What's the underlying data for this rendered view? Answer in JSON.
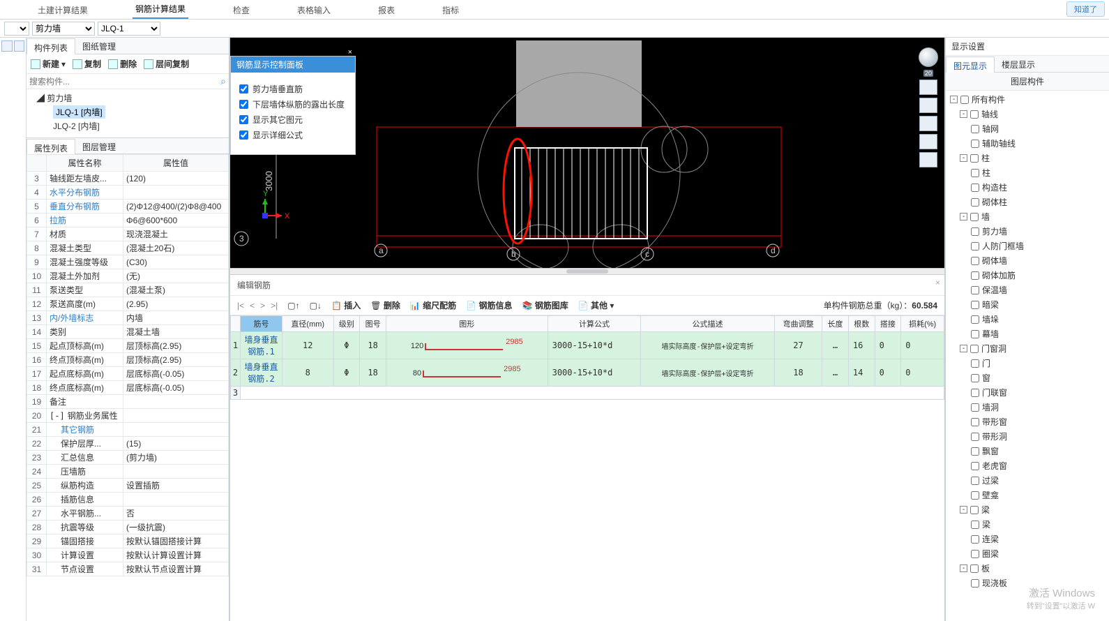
{
  "top_tabs": [
    "土建计算结果",
    "钢筋计算结果",
    "检查",
    "表格输入",
    "报表",
    "指标"
  ],
  "top_tabs_active": 1,
  "know_it": "知道了",
  "dd": {
    "first": "",
    "cat": "剪力墙",
    "item": "JLQ-1"
  },
  "left": {
    "tabs": [
      "构件列表",
      "图纸管理"
    ],
    "toolbar": {
      "new": "新建",
      "copy": "复制",
      "del": "删除",
      "floorcopy": "层间复制"
    },
    "search_ph": "搜索构件...",
    "tree_root": "剪力墙",
    "tree_items": [
      "JLQ-1 [内墙]",
      "JLQ-2 [内墙]"
    ],
    "tree_sel": 0,
    "tabs2": [
      "属性列表",
      "图层管理"
    ],
    "prop_headers": [
      "",
      "属性名称",
      "属性值"
    ],
    "props": [
      {
        "n": "3",
        "name": "轴线距左墙皮...",
        "val": "(120)"
      },
      {
        "n": "4",
        "name": "水平分布钢筋",
        "val": "",
        "blue": true
      },
      {
        "n": "5",
        "name": "垂直分布钢筋",
        "val": "(2)Φ12@400/(2)Φ8@400",
        "blue": true
      },
      {
        "n": "6",
        "name": "拉筋",
        "val": "Φ6@600*600",
        "blue": true
      },
      {
        "n": "7",
        "name": "材质",
        "val": "现浇混凝土"
      },
      {
        "n": "8",
        "name": "混凝土类型",
        "val": "(混凝土20石)"
      },
      {
        "n": "9",
        "name": "混凝土强度等级",
        "val": "(C30)"
      },
      {
        "n": "10",
        "name": "混凝土外加剂",
        "val": "(无)"
      },
      {
        "n": "11",
        "name": "泵送类型",
        "val": "(混凝土泵)"
      },
      {
        "n": "12",
        "name": "泵送高度(m)",
        "val": "(2.95)"
      },
      {
        "n": "13",
        "name": "内/外墙标志",
        "val": "内墙",
        "blue": true
      },
      {
        "n": "14",
        "name": "类别",
        "val": "混凝土墙"
      },
      {
        "n": "15",
        "name": "起点顶标高(m)",
        "val": "层顶标高(2.95)"
      },
      {
        "n": "16",
        "name": "终点顶标高(m)",
        "val": "层顶标高(2.95)"
      },
      {
        "n": "17",
        "name": "起点底标高(m)",
        "val": "层底标高(-0.05)"
      },
      {
        "n": "18",
        "name": "终点底标高(m)",
        "val": "层底标高(-0.05)"
      },
      {
        "n": "19",
        "name": "备注",
        "val": ""
      },
      {
        "n": "20",
        "name": "钢筋业务属性",
        "val": "",
        "exp": "-"
      },
      {
        "n": "21",
        "name": "其它钢筋",
        "val": "",
        "indent": 1,
        "blue": true
      },
      {
        "n": "22",
        "name": "保护层厚...",
        "val": "(15)",
        "indent": 1
      },
      {
        "n": "23",
        "name": "汇总信息",
        "val": "(剪力墙)",
        "indent": 1
      },
      {
        "n": "24",
        "name": "压墙筋",
        "val": "",
        "indent": 1
      },
      {
        "n": "25",
        "name": "纵筋构造",
        "val": "设置插筋",
        "indent": 1
      },
      {
        "n": "26",
        "name": "插筋信息",
        "val": "",
        "indent": 1
      },
      {
        "n": "27",
        "name": "水平钢筋...",
        "val": "否",
        "indent": 1
      },
      {
        "n": "28",
        "name": "抗震等级",
        "val": "(一级抗震)",
        "indent": 1
      },
      {
        "n": "29",
        "name": "锚固搭接",
        "val": "按默认锚固搭接计算",
        "indent": 1
      },
      {
        "n": "30",
        "name": "计算设置",
        "val": "按默认计算设置计算",
        "indent": 1
      },
      {
        "n": "31",
        "name": "节点设置",
        "val": "按默认节点设置计算",
        "indent": 1
      }
    ]
  },
  "floatpanel": {
    "title": "钢筋显示控制面板",
    "items": [
      "剪力墙垂直筋",
      "下层墙体纵筋的露出长度",
      "显示其它图元",
      "显示详细公式"
    ]
  },
  "viewport": {
    "dim_label": "3000",
    "axis_y": "Y",
    "axis_x": "X",
    "mark3": "3",
    "marks": [
      "a",
      "b",
      "c",
      "d"
    ]
  },
  "bottom": {
    "title": "编辑钢筋",
    "btn": {
      "ins": "插入",
      "del": "删除",
      "scale": "缩尺配筋",
      "info": "钢筋信息",
      "lib": "钢筋图库",
      "other": "其他"
    },
    "weight_label": "单构件钢筋总重（kg）：",
    "weight_val": "60.584",
    "cols": [
      "",
      "筋号",
      "直径(mm)",
      "级别",
      "图号",
      "图形",
      "计算公式",
      "公式描述",
      "弯曲调整",
      "长度",
      "根数",
      "搭接",
      "损耗(%)"
    ],
    "rows": [
      {
        "idx": "1",
        "name": "墙身垂直钢筋.1",
        "dia": "12",
        "grade": "Φ",
        "code": "18",
        "shape_l": "120",
        "shape_r": "2985",
        "formula": "3000-15+10*d",
        "desc": "墙实际高度-保护层+设定弯折",
        "bend": "27",
        "len": "…",
        "count": "16",
        "lap": "0",
        "loss": "0"
      },
      {
        "idx": "2",
        "name": "墙身垂直钢筋.2",
        "dia": "8",
        "grade": "Φ",
        "code": "18",
        "shape_l": "80",
        "shape_r": "2985",
        "formula": "3000-15+10*d",
        "desc": "墙实际高度-保护层+设定弯折",
        "bend": "18",
        "len": "…",
        "count": "14",
        "lap": "0",
        "loss": "0"
      }
    ],
    "empty_row": "3"
  },
  "right": {
    "title": "显示设置",
    "tabs": [
      "图元显示",
      "楼层显示"
    ],
    "subtitle": "图层构件",
    "tree": [
      {
        "lv": 0,
        "tgl": "-",
        "label": "所有构件"
      },
      {
        "lv": 1,
        "tgl": "-",
        "label": "轴线"
      },
      {
        "lv": 2,
        "label": "轴网"
      },
      {
        "lv": 2,
        "label": "辅助轴线"
      },
      {
        "lv": 1,
        "tgl": "-",
        "label": "柱"
      },
      {
        "lv": 2,
        "label": "柱"
      },
      {
        "lv": 2,
        "label": "构造柱"
      },
      {
        "lv": 2,
        "label": "砌体柱"
      },
      {
        "lv": 1,
        "tgl": "-",
        "label": "墙"
      },
      {
        "lv": 2,
        "label": "剪力墙"
      },
      {
        "lv": 2,
        "label": "人防门框墙"
      },
      {
        "lv": 2,
        "label": "砌体墙"
      },
      {
        "lv": 2,
        "label": "砌体加筋"
      },
      {
        "lv": 2,
        "label": "保温墙"
      },
      {
        "lv": 2,
        "label": "暗梁"
      },
      {
        "lv": 2,
        "label": "墙垛"
      },
      {
        "lv": 2,
        "label": "幕墙"
      },
      {
        "lv": 1,
        "tgl": "-",
        "label": "门窗洞"
      },
      {
        "lv": 2,
        "label": "门"
      },
      {
        "lv": 2,
        "label": "窗"
      },
      {
        "lv": 2,
        "label": "门联窗"
      },
      {
        "lv": 2,
        "label": "墙洞"
      },
      {
        "lv": 2,
        "label": "带形窗"
      },
      {
        "lv": 2,
        "label": "带形洞"
      },
      {
        "lv": 2,
        "label": "飘窗"
      },
      {
        "lv": 2,
        "label": "老虎窗"
      },
      {
        "lv": 2,
        "label": "过梁"
      },
      {
        "lv": 2,
        "label": "壁龛"
      },
      {
        "lv": 1,
        "tgl": "-",
        "label": "梁"
      },
      {
        "lv": 2,
        "label": "梁"
      },
      {
        "lv": 2,
        "label": "连梁"
      },
      {
        "lv": 2,
        "label": "圈梁"
      },
      {
        "lv": 1,
        "tgl": "-",
        "label": "板"
      },
      {
        "lv": 2,
        "label": "现浇板"
      }
    ]
  },
  "wm": {
    "line1": "激活 Windows",
    "line2": "转到\"设置\"以激活 W"
  },
  "vpnav_num": "20"
}
